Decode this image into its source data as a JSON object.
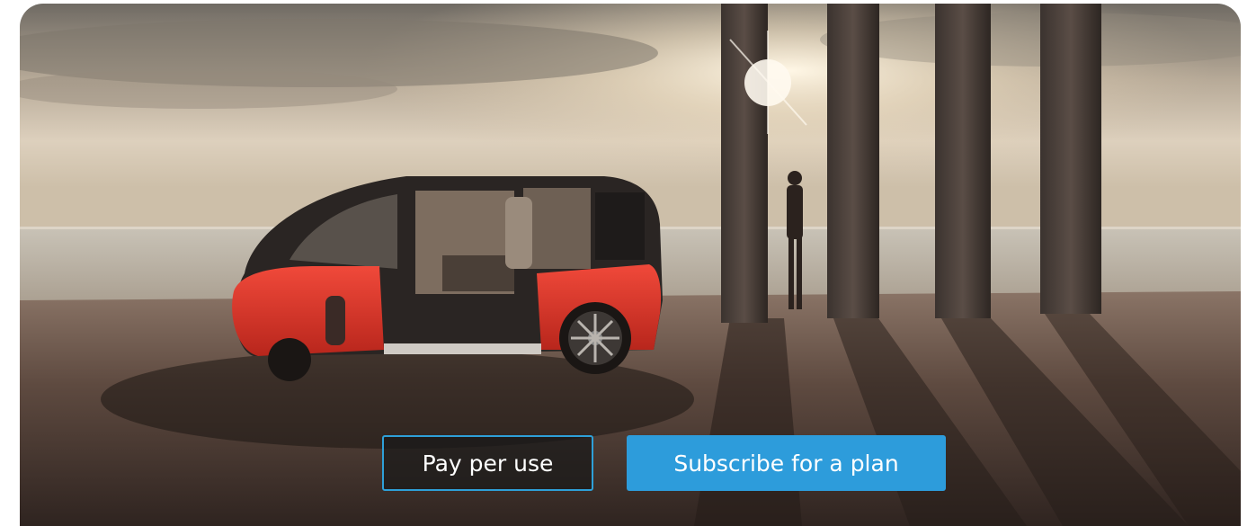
{
  "hero": {
    "image_icon": "concept-car-photo",
    "colors": {
      "accent": "#2d9cdb",
      "car_body": "#e33a2a"
    }
  },
  "actions": {
    "pay_per_use_label": "Pay per use",
    "subscribe_label": "Subscribe for a plan"
  }
}
